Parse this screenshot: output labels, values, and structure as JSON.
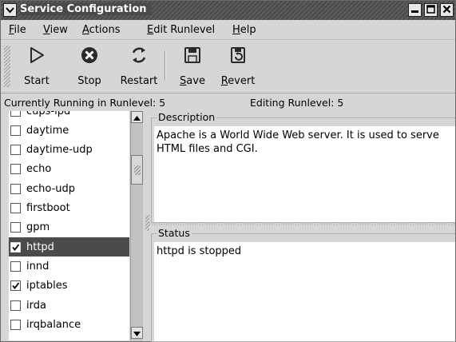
{
  "window": {
    "title": "Service Configuration"
  },
  "menu": {
    "file": {
      "u": "F",
      "rest": "ile"
    },
    "view": {
      "u": "V",
      "rest": "iew"
    },
    "actions": {
      "u": "A",
      "rest": "ctions"
    },
    "edit_runlevel": {
      "u": "E",
      "rest": "dit Runlevel"
    },
    "help": {
      "u": "H",
      "rest": "elp"
    }
  },
  "toolbar": {
    "start_label": "Start",
    "stop_label": "Stop",
    "restart_label": "Restart",
    "save": {
      "u": "S",
      "rest": "ave"
    },
    "revert": {
      "u": "R",
      "rest": "evert"
    }
  },
  "status": {
    "running": "Currently Running in Runlevel: 5",
    "editing": "Editing Runlevel: 5"
  },
  "services": [
    {
      "name": "cups-lpd",
      "checked": false,
      "selected": false
    },
    {
      "name": "daytime",
      "checked": false,
      "selected": false
    },
    {
      "name": "daytime-udp",
      "checked": false,
      "selected": false
    },
    {
      "name": "echo",
      "checked": false,
      "selected": false
    },
    {
      "name": "echo-udp",
      "checked": false,
      "selected": false
    },
    {
      "name": "firstboot",
      "checked": false,
      "selected": false
    },
    {
      "name": "gpm",
      "checked": false,
      "selected": false
    },
    {
      "name": "httpd",
      "checked": true,
      "selected": true
    },
    {
      "name": "innd",
      "checked": false,
      "selected": false
    },
    {
      "name": "iptables",
      "checked": true,
      "selected": false
    },
    {
      "name": "irda",
      "checked": false,
      "selected": false
    },
    {
      "name": "irqbalance",
      "checked": false,
      "selected": false
    }
  ],
  "description": {
    "legend": "Description",
    "text": "Apache is a World Wide Web server.  It is used to serve HTML files and CGI."
  },
  "status_panel": {
    "legend": "Status",
    "text": "httpd is stopped"
  },
  "colors": {
    "selection": "#4b4b4b",
    "titlebar": "#4a4a4a"
  }
}
